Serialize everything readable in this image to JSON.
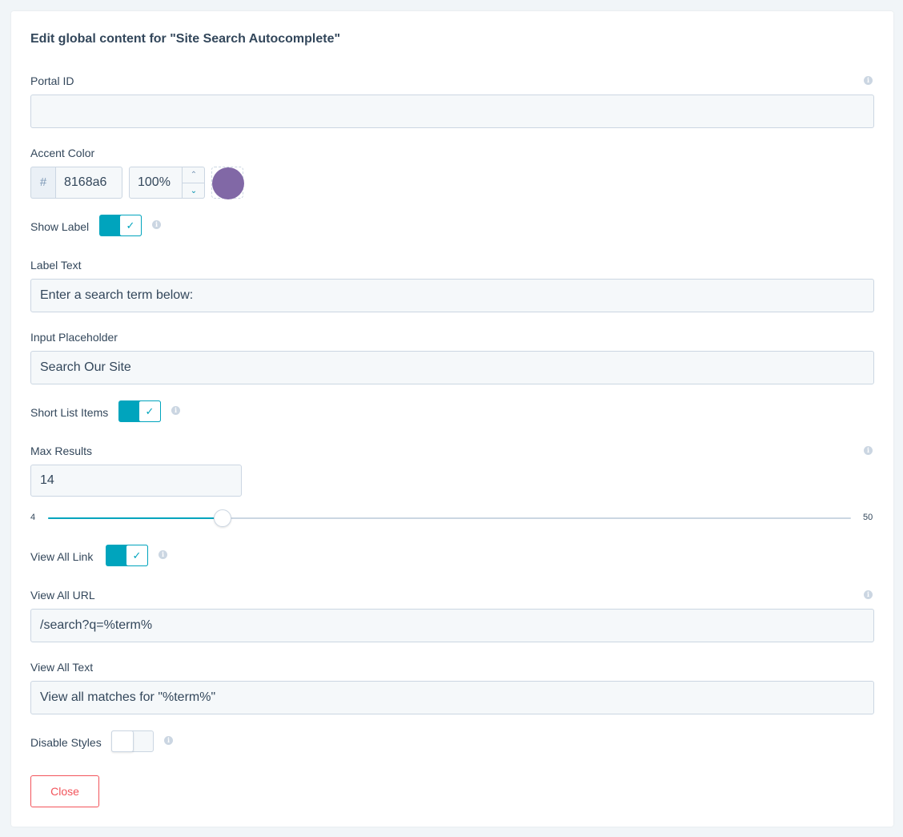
{
  "dialog": {
    "title": "Edit global content for \"Site Search Autocomplete\"",
    "close_label": "Close"
  },
  "fields": {
    "portal_id": {
      "label": "Portal ID",
      "value": ""
    },
    "accent_color": {
      "label": "Accent Color",
      "hash": "#",
      "hex": "8168a6",
      "opacity": "100%",
      "swatch": "#8168a6"
    },
    "show_label": {
      "label": "Show Label",
      "on": true
    },
    "label_text": {
      "label": "Label Text",
      "value": "Enter a search term below:"
    },
    "input_placeholder": {
      "label": "Input Placeholder",
      "value": "Search Our Site"
    },
    "short_list_items": {
      "label": "Short List Items",
      "on": true
    },
    "max_results": {
      "label": "Max Results",
      "value": "14",
      "min": "4",
      "max": "50"
    },
    "view_all_link": {
      "label": "View All Link",
      "on": true
    },
    "view_all_url": {
      "label": "View All URL",
      "value": "/search?q=%term%"
    },
    "view_all_text": {
      "label": "View All Text",
      "value": "View all matches for \"%term%\""
    },
    "disable_styles": {
      "label": "Disable Styles",
      "on": false
    }
  },
  "icons": {
    "info": "info-icon",
    "check": "check-icon",
    "chevron_up": "chevron-up-icon",
    "chevron_down": "chevron-down-icon"
  },
  "colors": {
    "accent": "#00a4bd",
    "danger": "#f2545b",
    "text": "#33475b"
  }
}
